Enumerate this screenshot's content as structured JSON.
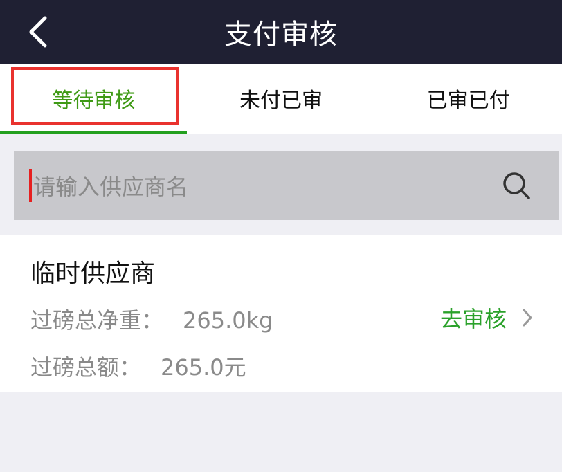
{
  "header": {
    "title": "支付审核"
  },
  "tabs": [
    {
      "label": "等待审核",
      "active": true
    },
    {
      "label": "未付已审",
      "active": false
    },
    {
      "label": "已审已付",
      "active": false
    }
  ],
  "search": {
    "placeholder": "请输入供应商名"
  },
  "list": [
    {
      "supplier": "临时供应商",
      "net_weight_label": "过磅总净重：",
      "net_weight_value": "265.0kg",
      "amount_label": "过磅总额：",
      "amount_value": "265.0元",
      "action_label": "去审核"
    }
  ],
  "colors": {
    "header_bg": "#1f2033",
    "active_tab": "#3f9a15",
    "underline": "#23a01f",
    "highlight": "#e9322e",
    "action": "#2aa12a",
    "search_bg": "#c8c8cc"
  }
}
